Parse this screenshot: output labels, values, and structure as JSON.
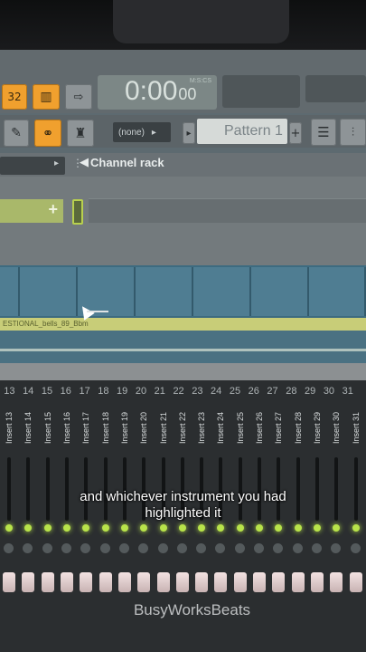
{
  "toolbar": {
    "song_mode_label": "32",
    "record_label": "",
    "time_display": "0:00",
    "time_ms": "00",
    "time_unit": "M:S:CS",
    "snap_value": "(none)",
    "pattern_name": "Pattern 1",
    "pattern_add_label": "+"
  },
  "channel_rack": {
    "title": "Channel rack"
  },
  "playlist": {
    "clip_name": "ESTIONAL_bells_89_Bbm"
  },
  "mixer": {
    "track_numbers": [
      "13",
      "14",
      "15",
      "16",
      "17",
      "18",
      "19",
      "20",
      "21",
      "22",
      "23",
      "24",
      "25",
      "26",
      "27",
      "28",
      "29",
      "30",
      "31"
    ],
    "insert_labels": [
      "Insert 13",
      "Insert 14",
      "Insert 15",
      "Insert 16",
      "Insert 17",
      "Insert 18",
      "Insert 19",
      "Insert 20",
      "Insert 21",
      "Insert 22",
      "Insert 23",
      "Insert 24",
      "Insert 25",
      "Insert 26",
      "Insert 27",
      "Insert 28",
      "Insert 29",
      "Insert 30",
      "Insert 31"
    ]
  },
  "caption": {
    "line1": "and whichever instrument you had",
    "line2": "highlighted it"
  },
  "watermark": "BusyWorksBeats",
  "colors": {
    "accent_orange": "#f0a02e",
    "led_green": "#b8e34a",
    "playlist_blue": "#4f7d92"
  }
}
